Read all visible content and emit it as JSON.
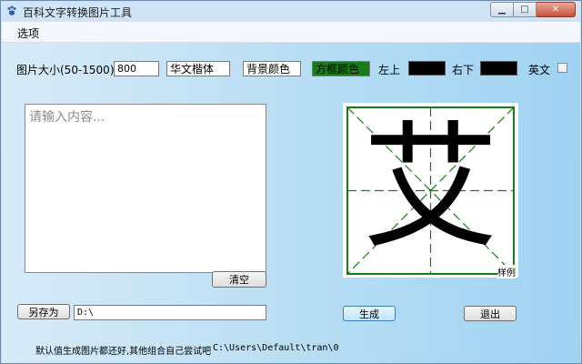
{
  "window": {
    "title": "百科文字转换图片工具"
  },
  "menu": {
    "options": "选项"
  },
  "settings": {
    "size_label": "图片大小(50-1500)",
    "size_value": "800",
    "font_button": "华文楷体",
    "bg_color_button": "背景颜色",
    "frame_color_button": "方框颜色",
    "top_left_label": "左上",
    "bottom_right_label": "右下",
    "english_label": "英文"
  },
  "editor": {
    "placeholder": "请输入内容...",
    "clear_button": "清空"
  },
  "save": {
    "save_as_button": "另存为",
    "path_value": "D:\\"
  },
  "preview": {
    "character": "艾",
    "sample_label": "样例"
  },
  "actions": {
    "generate_button": "生成",
    "exit_button": "退出"
  },
  "status": {
    "hint": "默认值生成图片都还好,其他组合自己尝试吧",
    "output_path": "C:\\Users\\Default\\tran\\0"
  },
  "colors": {
    "frame": "#1a7a1a",
    "top_left": "#000000",
    "bottom_right": "#000000"
  }
}
